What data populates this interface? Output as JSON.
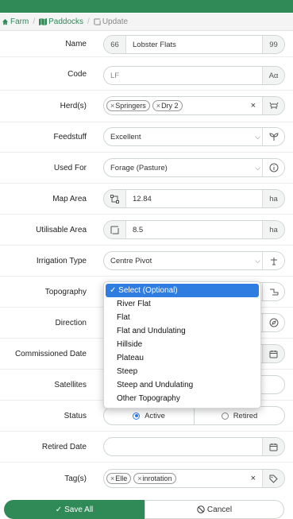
{
  "breadcrumb": {
    "farm": "Farm",
    "paddocks": "Paddocks",
    "current": "Update"
  },
  "form": {
    "name": {
      "label": "Name",
      "prefix": "66",
      "value": "Lobster Flats",
      "suffix": "99"
    },
    "code": {
      "label": "Code",
      "placeholder": "LF",
      "suffix": "Aα"
    },
    "herds": {
      "label": "Herd(s)",
      "chips": [
        "Springers",
        "Dry 2"
      ],
      "clear": "×"
    },
    "feedstuff": {
      "label": "Feedstuff",
      "value": "Excellent"
    },
    "used_for": {
      "label": "Used For",
      "value": "Forage (Pasture)"
    },
    "map_area": {
      "label": "Map Area",
      "value": "12.84",
      "unit": "ha"
    },
    "utilisable_area": {
      "label": "Utilisable Area",
      "value": "8.5",
      "unit": "ha"
    },
    "irrigation_type": {
      "label": "Irrigation Type",
      "value": "Centre Pivot"
    },
    "topography": {
      "label": "Topography"
    },
    "direction": {
      "label": "Direction"
    },
    "commissioned_date": {
      "label": "Commissioned Date"
    },
    "satellites": {
      "label": "Satellites"
    },
    "status": {
      "label": "Status",
      "options": [
        "Active",
        "Retired"
      ],
      "selected": "Active"
    },
    "retired_date": {
      "label": "Retired Date"
    },
    "tags": {
      "label": "Tag(s)",
      "chips": [
        "Elle",
        "inrotation"
      ],
      "clear": "×"
    }
  },
  "topography_dropdown": {
    "options": [
      "✓ Select (Optional)",
      "River Flat",
      "Flat",
      "Flat and Undulating",
      "Hillside",
      "Plateau",
      "Steep",
      "Steep and Undulating",
      "Other Topography"
    ],
    "selected_index": 0
  },
  "actions": {
    "save": "Save All",
    "cancel": "Cancel"
  },
  "colors": {
    "brand": "#2f8a58",
    "select_highlight": "#2f7de1"
  }
}
